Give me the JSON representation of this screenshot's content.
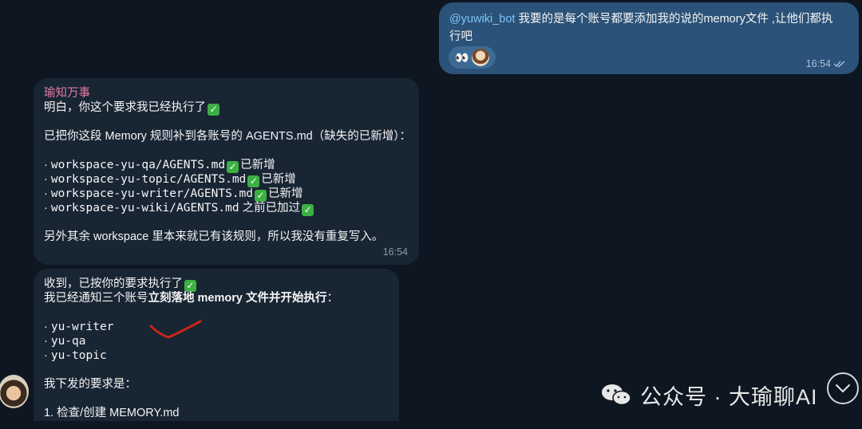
{
  "outgoing": {
    "mention": "@yuwiki_bot",
    "text_line1": " 我要的是每个账号都要添加我的说的memory文件 ,让他们都执",
    "text_line2": "行吧",
    "reaction_emoji": "👀",
    "time": "16:54"
  },
  "message1": {
    "sender": "瑜知万事",
    "line1": "明白，你这个要求我已经执行了",
    "line2": "已把你这段 Memory 规则补到各账号的 AGENTS.md（缺失的已新增）：",
    "items": [
      {
        "path": "workspace-yu-qa/AGENTS.md",
        "status": "已新增"
      },
      {
        "path": "workspace-yu-topic/AGENTS.md",
        "status": "已新增"
      },
      {
        "path": "workspace-yu-writer/AGENTS.md",
        "status": "已新增"
      },
      {
        "path": "workspace-yu-wiki/AGENTS.md",
        "status": "之前已加过"
      }
    ],
    "footer": "另外其余 workspace 里本来就已有该规则，所以我没有重复写入。",
    "time": "16:54"
  },
  "message2": {
    "line1": "收到，已按你的要求执行了",
    "line2_prefix": "我已经通知三个账号",
    "line2_bold": "立刻落地 memory 文件并开始执行",
    "line2_suffix": "：",
    "accounts": [
      "yu-writer",
      "yu-qa",
      "yu-topic"
    ],
    "requirements_title": "我下发的要求是：",
    "step1": "1. 检查/创建 MEMORY.md"
  },
  "watermark": {
    "text": "公众号 · 大瑜聊AI"
  },
  "colors": {
    "background": "#0e1621",
    "outgoing_bubble": "#2b5278",
    "incoming_bubble": "#182533",
    "sender_name": "#e47ca6",
    "mention": "#7cc4f7",
    "check": "#3cb043",
    "annotation_mark": "#c8261c"
  },
  "icons": [
    "double-check-icon",
    "check-mark-emoji-icon",
    "wechat-icon",
    "chevron-down-icon",
    "eyes-emoji-icon"
  ]
}
